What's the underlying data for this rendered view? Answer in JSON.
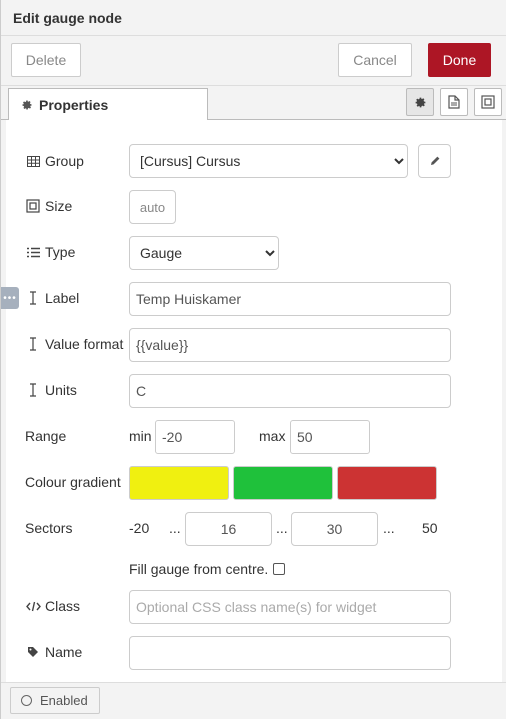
{
  "header": {
    "title": "Edit gauge node"
  },
  "toolbar": {
    "delete_label": "Delete",
    "cancel_label": "Cancel",
    "done_label": "Done"
  },
  "tabs": {
    "properties_label": "Properties"
  },
  "form": {
    "group": {
      "label": "Group",
      "value": "[Cursus] Cursus"
    },
    "size": {
      "label": "Size",
      "value": "auto"
    },
    "type": {
      "label": "Type",
      "value": "Gauge"
    },
    "label_field": {
      "label": "Label",
      "value": "Temp Huiskamer"
    },
    "value_format": {
      "label": "Value format",
      "value": "{{value}}"
    },
    "units": {
      "label": "Units",
      "value": "C"
    },
    "range": {
      "label": "Range",
      "min_label": "min",
      "min_value": "-20",
      "max_label": "max",
      "max_value": "50"
    },
    "colour_gradient": {
      "label": "Colour gradient",
      "colors": [
        "#f0f010",
        "#1fc13b",
        "#cc3333"
      ]
    },
    "sectors": {
      "label": "Sectors",
      "start": "-20",
      "dots1": "...",
      "mid1": "16",
      "dots2": "...",
      "mid2": "30",
      "dots3": "...",
      "end": "50"
    },
    "fill_centre": {
      "label": "Fill gauge from centre.",
      "checked": false
    },
    "class_field": {
      "label": "Class",
      "placeholder": "Optional CSS class name(s) for widget"
    },
    "name_field": {
      "label": "Name",
      "value": ""
    }
  },
  "footer": {
    "enabled_label": "Enabled"
  },
  "colors": {
    "primary": "#ad1625"
  }
}
